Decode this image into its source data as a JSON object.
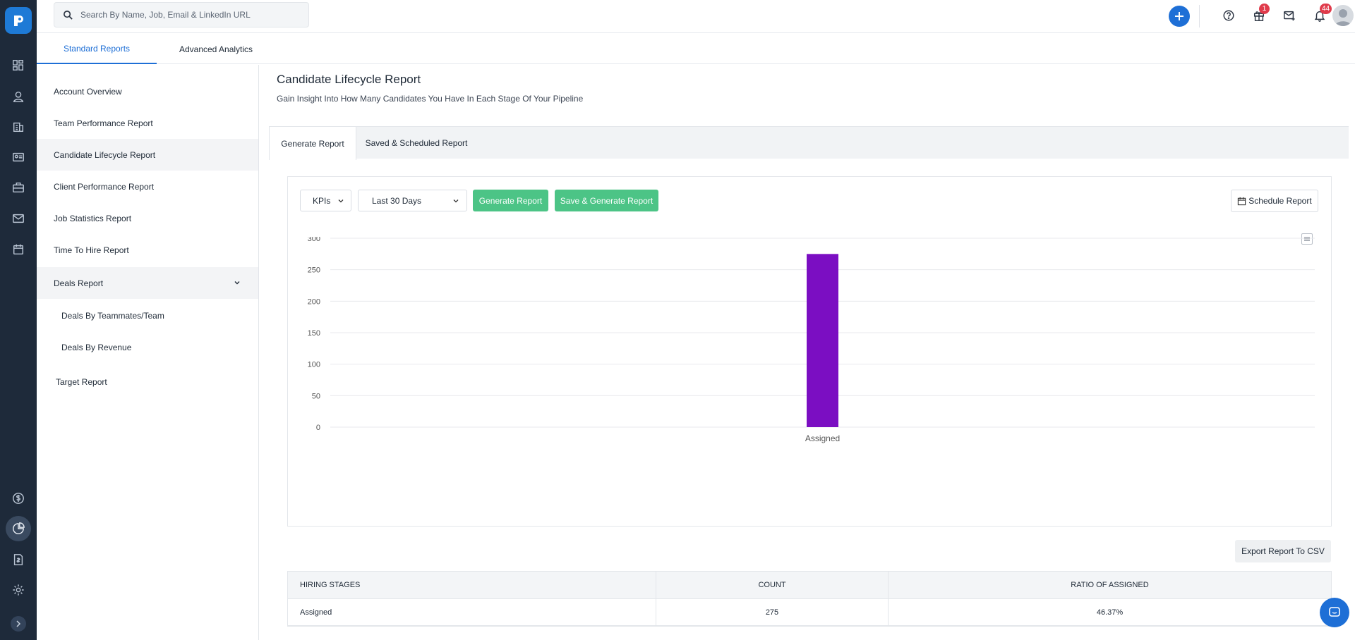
{
  "search": {
    "placeholder": "Search By Name, Job, Email & LinkedIn URL"
  },
  "topbar": {
    "gift_badge": "1",
    "notification_badge": "44"
  },
  "subnav": {
    "tabs": [
      {
        "label": "Standard Reports"
      },
      {
        "label": "Advanced Analytics"
      }
    ]
  },
  "sidebar": {
    "items": [
      {
        "label": "Account Overview"
      },
      {
        "label": "Team Performance Report"
      },
      {
        "label": "Candidate Lifecycle Report"
      },
      {
        "label": "Client Performance Report"
      },
      {
        "label": "Job Statistics Report"
      },
      {
        "label": "Time To Hire Report"
      },
      {
        "label": "Deals Report"
      },
      {
        "label": "Deals By Teammates/Team"
      },
      {
        "label": "Deals By Revenue"
      },
      {
        "label": "Target Report"
      }
    ]
  },
  "page": {
    "title": "Candidate Lifecycle Report",
    "subtitle": "Gain Insight Into How Many Candidates You Have In Each Stage Of Your Pipeline"
  },
  "tabs": [
    {
      "label": "Generate Report"
    },
    {
      "label": "Saved & Scheduled Report"
    }
  ],
  "controls": {
    "kpi_select": "KPIs",
    "range_select": "Last 30 Days",
    "generate_label": "Generate Report",
    "save_generate_label": "Save & Generate Report",
    "schedule_label": "Schedule Report",
    "export_label": "Export Report To CSV"
  },
  "colors": {
    "accent": "#1e6fd6",
    "green": "#4cc486",
    "bar": "#7b0ec2"
  },
  "chart_data": {
    "type": "bar",
    "categories": [
      "Assigned"
    ],
    "values": [
      275
    ],
    "ylim": [
      0,
      300
    ],
    "yticks": [
      0,
      50,
      100,
      150,
      200,
      250,
      300
    ],
    "grid": true
  },
  "table": {
    "headers": [
      "HIRING STAGES",
      "COUNT",
      "RATIO OF ASSIGNED"
    ],
    "rows": [
      [
        "Assigned",
        "275",
        "46.37%"
      ]
    ]
  }
}
